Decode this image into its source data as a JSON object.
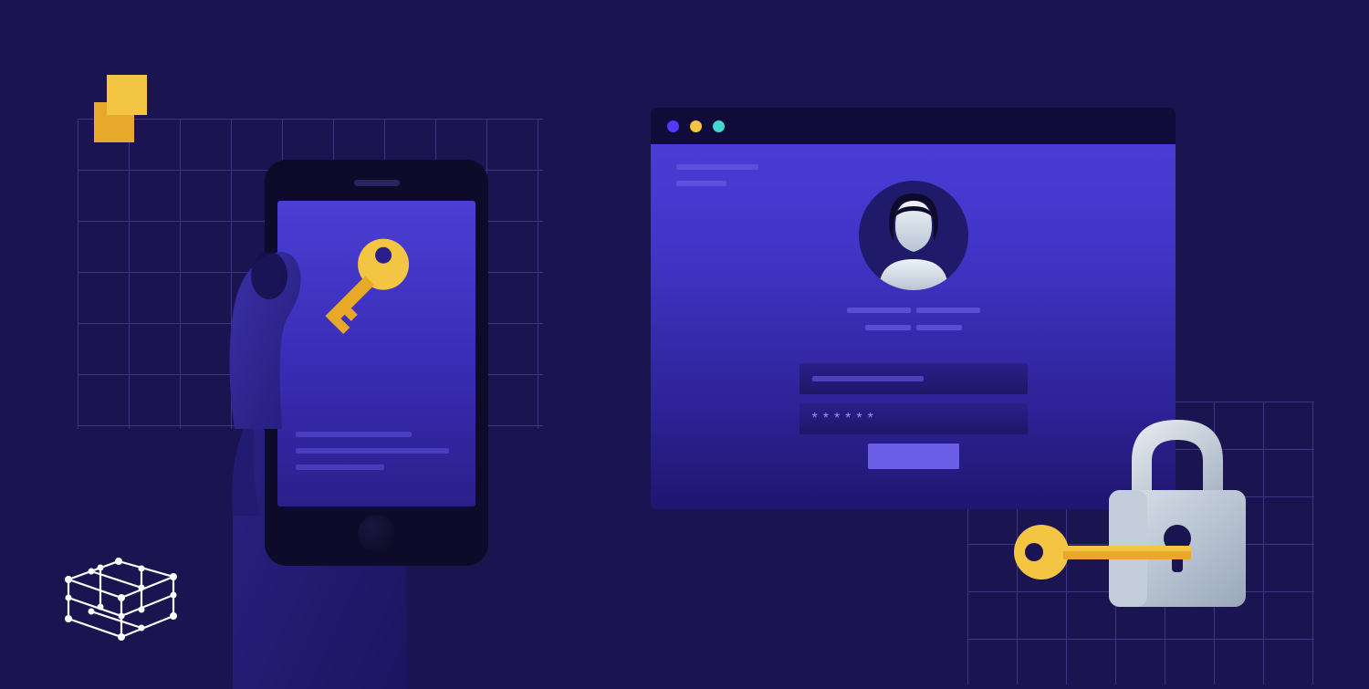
{
  "colors": {
    "background": "#1a1451",
    "grid": "#3d3488",
    "accent_yellow": "#f4c542",
    "accent_teal": "#3fd9d0",
    "accent_blue": "#5438ff",
    "window_gradient_top": "#4c3fd9",
    "window_gradient_bottom": "#1e1670",
    "lock_silver": "#c8d0db"
  },
  "icons": {
    "logo": "overlap-squares-icon",
    "network": "cube-network-icon",
    "phone_key": "key-icon",
    "avatar": "user-silhouette-icon",
    "padlock": "lock-icon",
    "padlock_key": "key-icon"
  },
  "browser": {
    "traffic_lights": [
      "blue",
      "yellow",
      "teal"
    ],
    "form": {
      "username_placeholder": "",
      "password_value": "******",
      "login_label": ""
    }
  },
  "phone": {
    "text_lines": 3
  }
}
